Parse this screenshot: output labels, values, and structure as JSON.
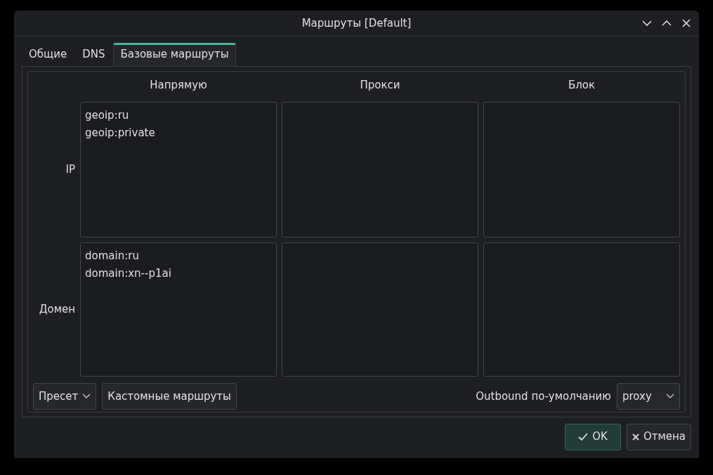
{
  "window": {
    "title": "Маршруты [Default]"
  },
  "tabs": [
    {
      "label": "Общие",
      "selected": false
    },
    {
      "label": "DNS",
      "selected": false
    },
    {
      "label": "Базовые маршруты",
      "selected": true
    }
  ],
  "routes": {
    "columns": [
      "Напрямую",
      "Прокси",
      "Блок"
    ],
    "rows": [
      {
        "label": "IP",
        "cells": [
          {
            "lines": [
              "geoip:ru",
              "geoip:private"
            ]
          },
          {},
          {}
        ]
      },
      {
        "label": "Домен",
        "cells": [
          {
            "lines": [
              "domain:ru",
              "domain:xn--p1ai"
            ]
          },
          {},
          {}
        ]
      }
    ]
  },
  "preset": {
    "label": "Пресет"
  },
  "custom_routes_button": "Кастомные маршруты",
  "default_outbound": {
    "label": "Outbound по-умолчанию",
    "value": "proxy"
  },
  "buttons": [
    {
      "kind": "ok",
      "label": "OK"
    },
    {
      "kind": "cancel",
      "label": "Отмена"
    }
  ]
}
